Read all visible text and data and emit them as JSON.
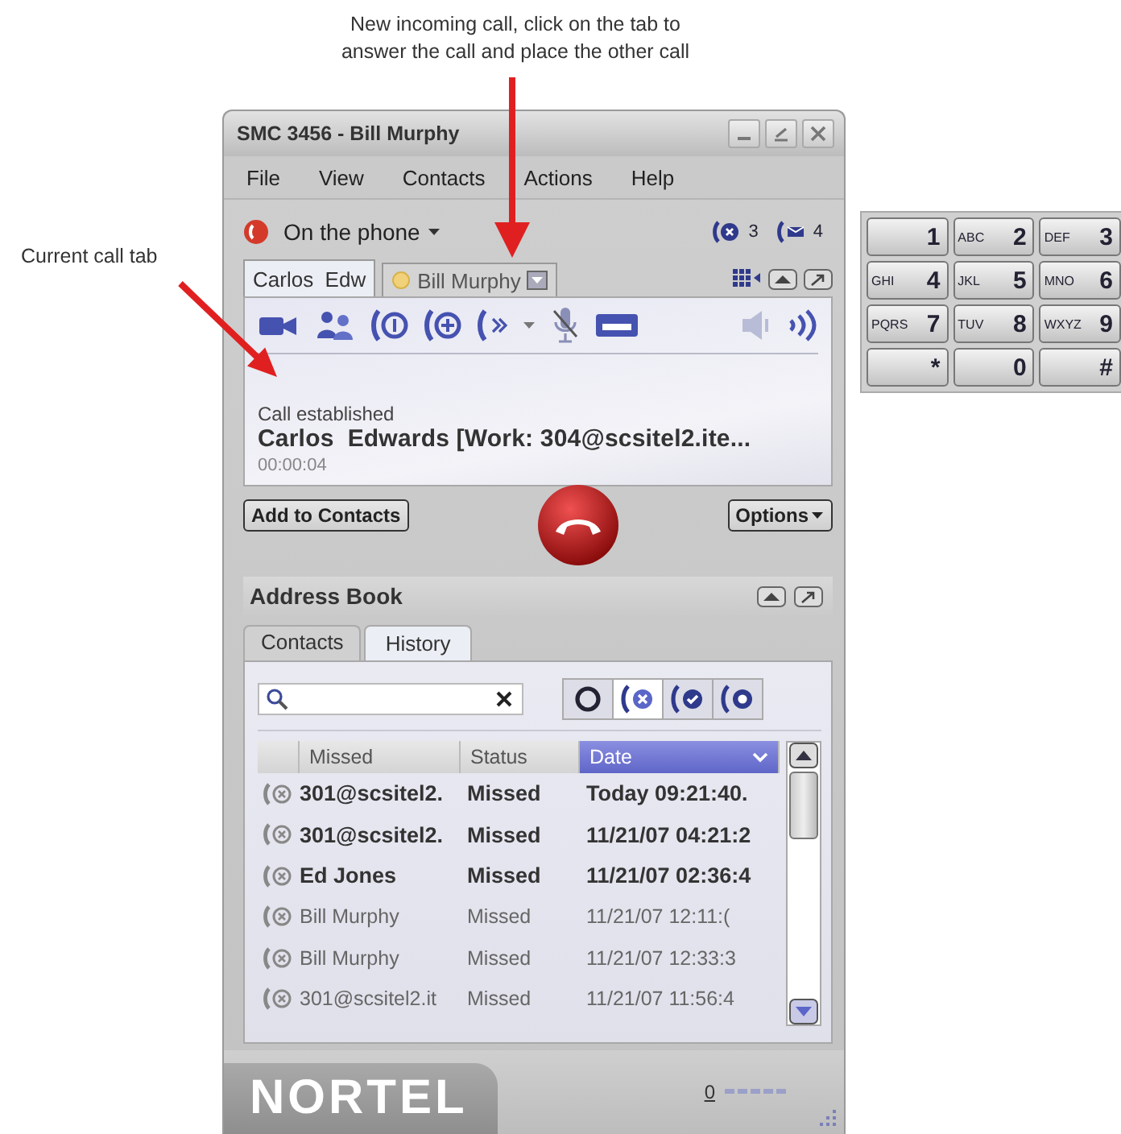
{
  "annotations": {
    "top": "New incoming call, click on the tab to\nanswer the call and place the other call",
    "left": "Current call tab"
  },
  "window": {
    "title": "SMC 3456 - Bill Murphy"
  },
  "menu": [
    "File",
    "View",
    "Contacts",
    "Actions",
    "Help"
  ],
  "presence": {
    "label": "On the phone"
  },
  "counters": [
    {
      "kind": "missed",
      "count": "3"
    },
    {
      "kind": "voicemail",
      "count": "4"
    }
  ],
  "call_tabs": [
    {
      "label": "Carlos  Edw",
      "selected": true,
      "incoming": false
    },
    {
      "label": "Bill Murphy",
      "selected": false,
      "incoming": true
    }
  ],
  "toolbar": [
    {
      "kind": "video"
    },
    {
      "kind": "conference"
    },
    {
      "kind": "hold"
    },
    {
      "kind": "add"
    },
    {
      "kind": "transfer"
    },
    {
      "kind": "mute"
    },
    {
      "kind": "voicemail"
    },
    {
      "kind": "gap"
    },
    {
      "kind": "speaker"
    },
    {
      "kind": "volume"
    }
  ],
  "call": {
    "state": "Call established",
    "party": "Carlos  Edwards [Work: 304@scsitel2.ite...",
    "timer": "00:00:04"
  },
  "buttons": {
    "add": "Add to Contacts",
    "options": "Options"
  },
  "address_book": {
    "title": "Address Book",
    "tabs": [
      {
        "label": "Contacts",
        "selected": false
      },
      {
        "label": "History",
        "selected": true
      }
    ],
    "filters": [
      {
        "kind": "all",
        "selected": false
      },
      {
        "kind": "missed",
        "selected": true
      },
      {
        "kind": "answered",
        "selected": false
      },
      {
        "kind": "dialed",
        "selected": false
      }
    ],
    "columns": [
      {
        "label": "Missed",
        "sorted": false
      },
      {
        "label": "Status",
        "sorted": false
      },
      {
        "label": "Date",
        "sorted": true
      }
    ],
    "rows": [
      {
        "name": "301@scsitel2.",
        "status": "Missed",
        "date": "Today 09:21:40.",
        "unread": true
      },
      {
        "name": "301@scsitel2.",
        "status": "Missed",
        "date": "11/21/07 04:21:2",
        "unread": true
      },
      {
        "name": "Ed Jones",
        "status": "Missed",
        "date": "11/21/07 02:36:4",
        "unread": true
      },
      {
        "name": "Bill Murphy",
        "status": "Missed",
        "date": "11/21/07 12:11:(",
        "unread": false
      },
      {
        "name": "Bill Murphy",
        "status": "Missed",
        "date": "11/21/07 12:33:3",
        "unread": false
      },
      {
        "name": "301@scsitel2.it",
        "status": "Missed",
        "date": "11/21/07 11:56:4",
        "unread": false
      }
    ]
  },
  "footer": {
    "logo": "NORTEL",
    "mic_level": "0"
  },
  "keypad": [
    {
      "key": "1"
    },
    {
      "letters": "ABC",
      "key": "2"
    },
    {
      "letters": "DEF",
      "key": "3"
    },
    {
      "letters": "GHI",
      "key": "4"
    },
    {
      "letters": "JKL",
      "key": "5"
    },
    {
      "letters": "MNO",
      "key": "6"
    },
    {
      "letters": "PQRS",
      "key": "7"
    },
    {
      "letters": "TUV",
      "key": "8"
    },
    {
      "letters": "WXYZ",
      "key": "9"
    },
    {
      "key": "*"
    },
    {
      "key": "0"
    },
    {
      "key": "#"
    }
  ]
}
